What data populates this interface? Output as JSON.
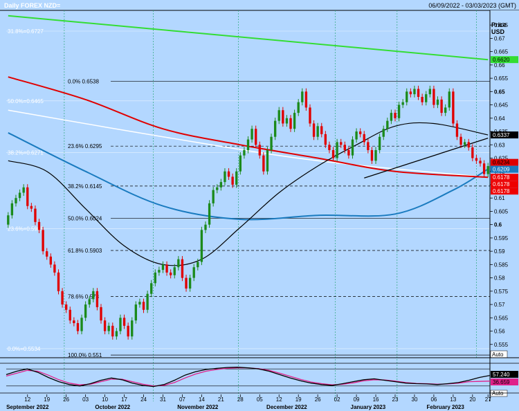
{
  "chart_data": {
    "type": "candlestick",
    "title": "Daily FOREX NZD=",
    "date_range": "06/09/2022 - 03/03/2023 (GMT)",
    "y_axis_label_line1": "Price",
    "y_axis_label_line2": "USD",
    "ylim": [
      0.55,
      0.6805
    ],
    "y_ticks": [
      0.555,
      0.56,
      0.565,
      0.57,
      0.575,
      0.58,
      0.585,
      0.59,
      0.595,
      0.6,
      0.605,
      0.61,
      0.615,
      0.62,
      0.625,
      0.63,
      0.635,
      0.64,
      0.645,
      0.65,
      0.655,
      0.66,
      0.665,
      0.67,
      0.675
    ],
    "y_tick_labels": [
      "0.555",
      "0.56",
      "0.565",
      "0.57",
      "0.575",
      "0.58",
      "0.585",
      "0.59",
      "0.595",
      "0.6",
      "0.605",
      "0.61",
      "0.615",
      "0.62",
      "0.625",
      "0.63",
      "0.635",
      "0.64",
      "0.645",
      "0.65",
      "0.655",
      "0.66",
      "0.665",
      "0.67",
      "0.675"
    ],
    "bold_ticks": [
      "0.6",
      "0.65"
    ],
    "n_bars": 125,
    "x_day_labels": [
      "12",
      "19",
      "26",
      "03",
      "10",
      "17",
      "24",
      "31",
      "07",
      "14",
      "21",
      "28",
      "05",
      "12",
      "19",
      "26",
      "02",
      "09",
      "16",
      "23",
      "30",
      "06",
      "13",
      "20",
      "27"
    ],
    "months": [
      "September 2022",
      "October 2022",
      "November 2022",
      "December 2022",
      "January 2023",
      "February 2023"
    ],
    "month_separators": [
      15,
      38,
      60,
      85,
      101
    ],
    "month_label_bars": [
      5,
      27,
      49,
      72,
      93,
      113
    ],
    "fib_levels": [
      {
        "label": "0.0%",
        "value": 0.6538,
        "text": "0.6538"
      },
      {
        "label": "23.6%",
        "value": 0.6295,
        "text": "0.6295"
      },
      {
        "label": "38.2%",
        "value": 0.6145,
        "text": "0.6145"
      },
      {
        "label": "50.0%",
        "value": 0.6024,
        "text": "0.6024"
      },
      {
        "label": "61.8%",
        "value": 0.5903,
        "text": "0.5903"
      },
      {
        "label": "78.6%",
        "value": 0.573,
        "text": "0.573"
      },
      {
        "label": "100.0%",
        "value": 0.551,
        "text": "0.551"
      }
    ],
    "faint_fib_levels": [
      {
        "text": "31.8%=0.6727",
        "value": 0.6727
      },
      {
        "text": "50.0%=0.6465",
        "value": 0.6465
      },
      {
        "text": "38.2%=0.6271",
        "value": 0.6271
      },
      {
        "text": "23.6%=0.5985",
        "value": 0.5985
      },
      {
        "text": "0.0%=0.5534",
        "value": 0.5534
      }
    ],
    "price_labels": [
      {
        "text": "0.6620",
        "value": 0.662,
        "color": "#33dd33",
        "fg": "#000000"
      },
      {
        "text": "0.6337",
        "value": 0.6337,
        "color": "#000000",
        "fg": "#ffffff"
      },
      {
        "text": "0.6234",
        "value": 0.6234,
        "color": "#dd0000",
        "fg": "#000000"
      },
      {
        "text": "0.6209",
        "value": 0.6209,
        "color": "#1a7bbf",
        "fg": "#ffffff"
      },
      {
        "text": "0.6178",
        "value": 0.6178,
        "color": "#ee0000",
        "fg": "#ffffff"
      },
      {
        "text": "0.6178",
        "value": 0.6178,
        "color": "#ee0000",
        "fg": "#ffffff"
      },
      {
        "text": "0.6178",
        "value": 0.6178,
        "color": "#ee0000",
        "fg": "#ffffff"
      }
    ],
    "close": [
      0.6035,
      0.608,
      0.61,
      0.612,
      0.614,
      0.607,
      0.606,
      0.601,
      0.598,
      0.59,
      0.588,
      0.585,
      0.582,
      0.575,
      0.57,
      0.568,
      0.564,
      0.563,
      0.56,
      0.565,
      0.57,
      0.572,
      0.575,
      0.569,
      0.564,
      0.56,
      0.562,
      0.558,
      0.56,
      0.565,
      0.562,
      0.558,
      0.564,
      0.57,
      0.571,
      0.568,
      0.574,
      0.578,
      0.582,
      0.583,
      0.585,
      0.582,
      0.581,
      0.584,
      0.587,
      0.58,
      0.576,
      0.58,
      0.584,
      0.586,
      0.598,
      0.6,
      0.608,
      0.613,
      0.614,
      0.616,
      0.62,
      0.618,
      0.615,
      0.62,
      0.626,
      0.628,
      0.632,
      0.636,
      0.63,
      0.626,
      0.62,
      0.628,
      0.633,
      0.639,
      0.643,
      0.638,
      0.64,
      0.636,
      0.642,
      0.646,
      0.65,
      0.644,
      0.638,
      0.633,
      0.637,
      0.634,
      0.63,
      0.628,
      0.625,
      0.631,
      0.63,
      0.628,
      0.626,
      0.632,
      0.635,
      0.634,
      0.631,
      0.628,
      0.624,
      0.628,
      0.633,
      0.636,
      0.639,
      0.642,
      0.64,
      0.645,
      0.646,
      0.65,
      0.649,
      0.651,
      0.648,
      0.646,
      0.649,
      0.651,
      0.645,
      0.647,
      0.642,
      0.644,
      0.65,
      0.638,
      0.633,
      0.63,
      0.631,
      0.629,
      0.625,
      0.624,
      0.623,
      0.619,
      0.622
    ],
    "open": [
      0.6,
      0.6035,
      0.608,
      0.61,
      0.612,
      0.614,
      0.607,
      0.606,
      0.601,
      0.598,
      0.59,
      0.588,
      0.585,
      0.582,
      0.575,
      0.57,
      0.568,
      0.564,
      0.563,
      0.56,
      0.565,
      0.57,
      0.572,
      0.575,
      0.569,
      0.564,
      0.56,
      0.562,
      0.558,
      0.56,
      0.565,
      0.562,
      0.558,
      0.564,
      0.57,
      0.571,
      0.568,
      0.574,
      0.578,
      0.582,
      0.583,
      0.585,
      0.582,
      0.581,
      0.584,
      0.587,
      0.58,
      0.576,
      0.58,
      0.584,
      0.586,
      0.598,
      0.6,
      0.608,
      0.613,
      0.614,
      0.616,
      0.62,
      0.618,
      0.615,
      0.62,
      0.626,
      0.628,
      0.632,
      0.636,
      0.63,
      0.626,
      0.62,
      0.628,
      0.633,
      0.639,
      0.643,
      0.638,
      0.64,
      0.636,
      0.642,
      0.646,
      0.65,
      0.644,
      0.638,
      0.633,
      0.637,
      0.634,
      0.63,
      0.628,
      0.625,
      0.631,
      0.63,
      0.628,
      0.626,
      0.632,
      0.635,
      0.634,
      0.631,
      0.628,
      0.624,
      0.628,
      0.633,
      0.636,
      0.639,
      0.642,
      0.64,
      0.645,
      0.646,
      0.65,
      0.649,
      0.651,
      0.648,
      0.646,
      0.649,
      0.651,
      0.645,
      0.647,
      0.642,
      0.644,
      0.65,
      0.638,
      0.633,
      0.63,
      0.631,
      0.629,
      0.625,
      0.624,
      0.623,
      0.619
    ],
    "ma_green": {
      "start": 0.6785,
      "end": 0.662
    },
    "ma_red": [
      [
        0,
        0.6555
      ],
      [
        20,
        0.647
      ],
      [
        40,
        0.636
      ],
      [
        60,
        0.63
      ],
      [
        80,
        0.625
      ],
      [
        100,
        0.62
      ],
      [
        124,
        0.6178
      ]
    ],
    "ma_blue": [
      [
        0,
        0.6345
      ],
      [
        20,
        0.62
      ],
      [
        40,
        0.607
      ],
      [
        60,
        0.602
      ],
      [
        80,
        0.6035
      ],
      [
        100,
        0.604
      ],
      [
        115,
        0.613
      ],
      [
        124,
        0.6209
      ]
    ],
    "ma_black": [
      [
        0,
        0.624
      ],
      [
        10,
        0.62
      ],
      [
        20,
        0.606
      ],
      [
        30,
        0.592
      ],
      [
        40,
        0.585
      ],
      [
        50,
        0.587
      ],
      [
        60,
        0.599
      ],
      [
        70,
        0.612
      ],
      [
        80,
        0.622
      ],
      [
        90,
        0.63
      ],
      [
        100,
        0.637
      ],
      [
        110,
        0.638
      ],
      [
        124,
        0.6337
      ]
    ],
    "ma_white": [
      [
        0,
        0.643
      ],
      [
        40,
        0.633
      ],
      [
        80,
        0.624
      ],
      [
        124,
        0.6178
      ]
    ],
    "trendline": [
      [
        92,
        0.6175
      ],
      [
        124,
        0.6325
      ]
    ],
    "stochastic": {
      "values": [
        "57.240",
        "36.659"
      ],
      "k_color": "#000000",
      "d_color": "#e0218a",
      "k": [
        60,
        72,
        80,
        68,
        50,
        35,
        25,
        20,
        28,
        40,
        48,
        42,
        30,
        22,
        18,
        25,
        40,
        58,
        70,
        78,
        82,
        85,
        86,
        84,
        80,
        72,
        60,
        48,
        38,
        30,
        25,
        22,
        28,
        35,
        42,
        45,
        40,
        35,
        30,
        28,
        27,
        25,
        28,
        32,
        40,
        50,
        57
      ],
      "d": [
        55,
        65,
        75,
        72,
        58,
        42,
        30,
        24,
        26,
        35,
        44,
        44,
        35,
        26,
        20,
        22,
        32,
        48,
        62,
        72,
        78,
        82,
        84,
        84,
        81,
        75,
        65,
        54,
        43,
        34,
        28,
        24,
        26,
        31,
        38,
        42,
        41,
        37,
        32,
        29,
        28,
        26,
        27,
        30,
        35,
        36,
        37
      ]
    },
    "auto_label": "Auto"
  }
}
